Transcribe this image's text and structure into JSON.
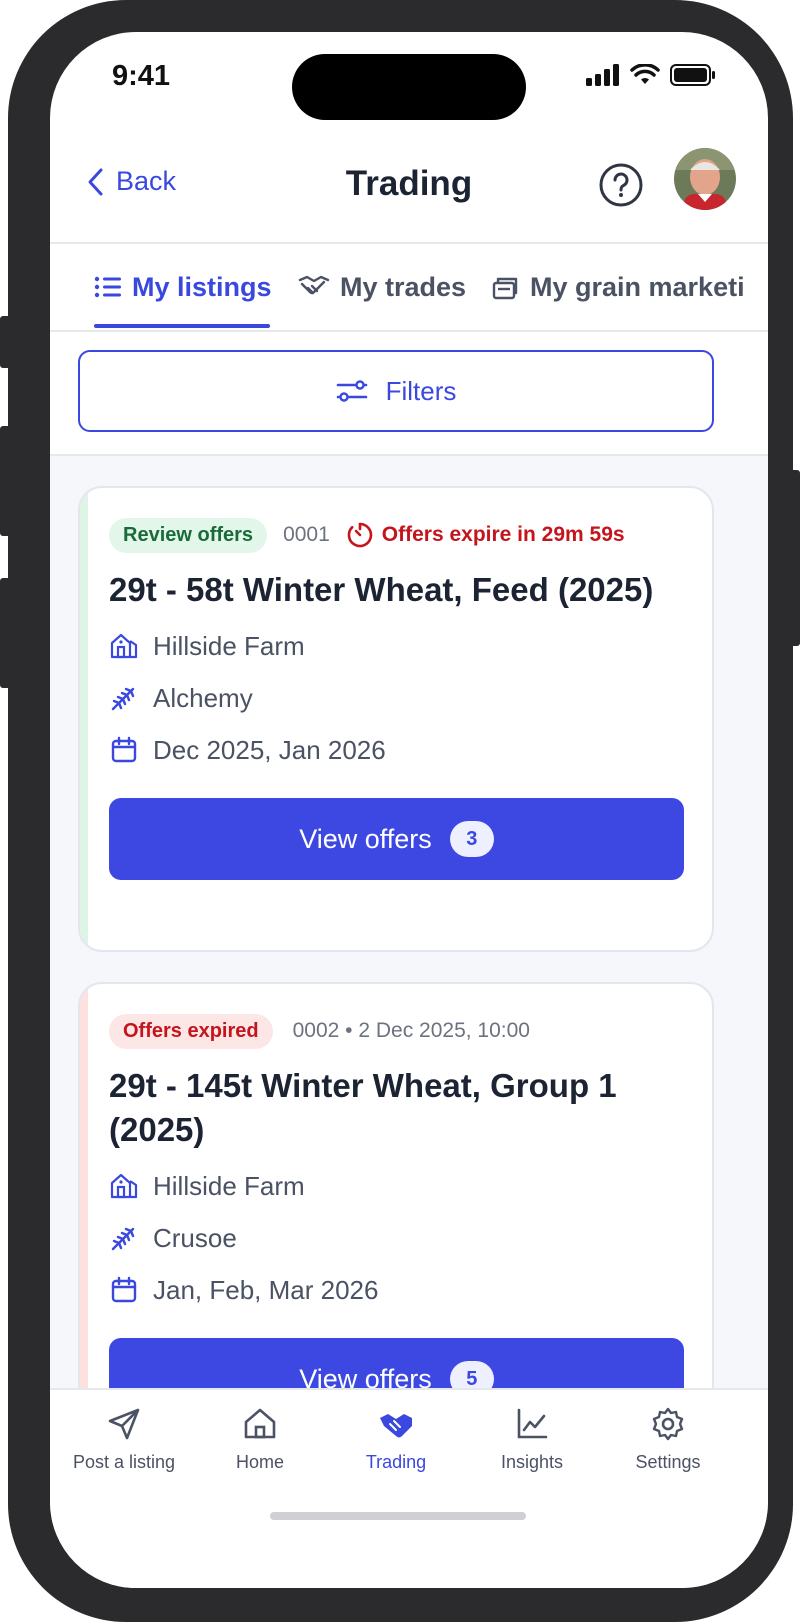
{
  "status_bar": {
    "time": "9:41"
  },
  "header": {
    "back_label": "Back",
    "title": "Trading"
  },
  "tabs": [
    {
      "label": "My listings",
      "active": true
    },
    {
      "label": "My trades",
      "active": false
    },
    {
      "label": "My grain marketi",
      "active": false
    }
  ],
  "filters": {
    "label": "Filters"
  },
  "listings": [
    {
      "status": "Review offers",
      "status_color": "green",
      "meta": "0001",
      "expiry": "Offers expire in 29m 59s",
      "title": "29t - 58t Winter Wheat, Feed (2025)",
      "farm": "Hillside Farm",
      "variety": "Alchemy",
      "dates": "Dec 2025, Jan 2026",
      "button_label": "View offers",
      "offer_count": "3"
    },
    {
      "status": "Offers expired",
      "status_color": "red",
      "meta": "0002 • 2 Dec 2025, 10:00",
      "expiry": "",
      "title": "29t - 145t Winter Wheat, Group 1 (2025)",
      "farm": "Hillside Farm",
      "variety": "Crusoe",
      "dates": "Jan, Feb, Mar 2026",
      "button_label": "View offers",
      "offer_count": "5"
    }
  ],
  "tab_bar": [
    {
      "label": "Post a listing",
      "icon": "send-icon",
      "active": false
    },
    {
      "label": "Home",
      "icon": "home-icon",
      "active": false
    },
    {
      "label": "Trading",
      "icon": "handshake-icon",
      "active": true
    },
    {
      "label": "Insights",
      "icon": "chart-icon",
      "active": false
    },
    {
      "label": "Settings",
      "icon": "gear-icon",
      "active": false
    }
  ],
  "colors": {
    "accent": "#3d48e2",
    "green_badge": "#e3f6ea",
    "red_badge": "#fde6e6",
    "text_dark": "#1c2333"
  }
}
